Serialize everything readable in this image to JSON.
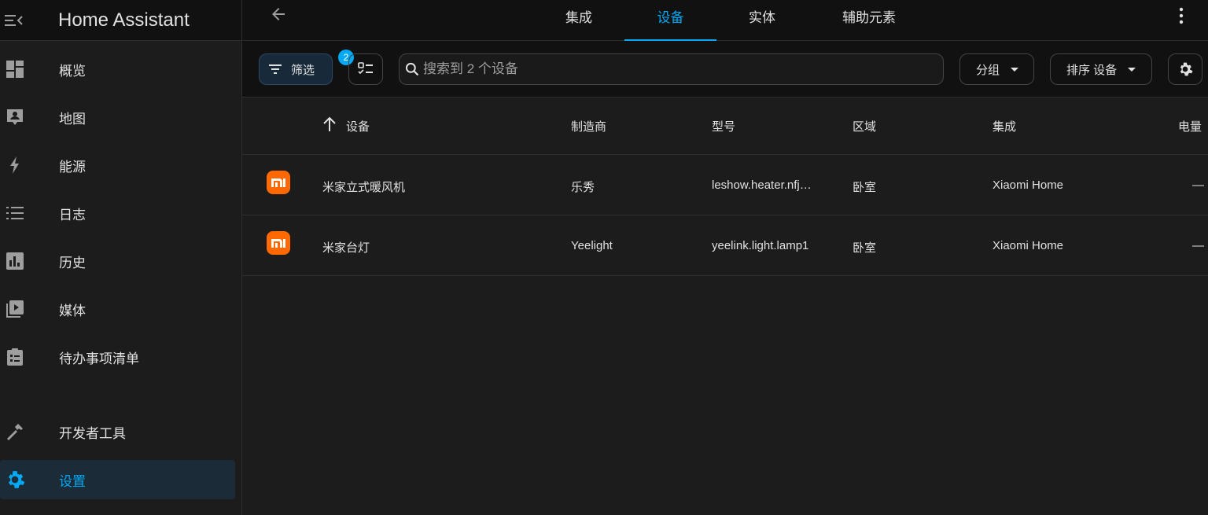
{
  "app": {
    "title": "Home Assistant"
  },
  "sidebar": {
    "items": [
      {
        "label": "概览",
        "icon": "dashboard-icon"
      },
      {
        "label": "地图",
        "icon": "map-account-icon"
      },
      {
        "label": "能源",
        "icon": "lightning-bolt-icon"
      },
      {
        "label": "日志",
        "icon": "list-icon"
      },
      {
        "label": "历史",
        "icon": "chart-box-icon"
      },
      {
        "label": "媒体",
        "icon": "play-box-multiple-icon"
      },
      {
        "label": "待办事项清单",
        "icon": "clipboard-list-icon"
      },
      {
        "label": "开发者工具",
        "icon": "hammer-icon"
      },
      {
        "label": "设置",
        "icon": "cog-icon",
        "active": true
      }
    ]
  },
  "tabs": [
    {
      "label": "集成"
    },
    {
      "label": "设备",
      "active": true
    },
    {
      "label": "实体"
    },
    {
      "label": "辅助元素"
    }
  ],
  "toolbar": {
    "filter_label": "筛选",
    "filter_count": "2",
    "search_placeholder": "搜索到 2 个设备",
    "group_label": "分组",
    "sort_label": "排序 设备"
  },
  "table": {
    "columns": [
      "设备",
      "制造商",
      "型号",
      "区域",
      "集成",
      "电量"
    ],
    "rows": [
      {
        "name": "米家立式暖风机",
        "manufacturer": "乐秀",
        "model": "leshow.heater.nfj…",
        "area": "卧室",
        "integration": "Xiaomi Home",
        "battery": "—"
      },
      {
        "name": "米家台灯",
        "manufacturer": "Yeelight",
        "model": "yeelink.light.lamp1",
        "area": "卧室",
        "integration": "Xiaomi Home",
        "battery": "—"
      }
    ]
  },
  "colors": {
    "accent": "#03a9f4",
    "brand_xiaomi": "#ff6900",
    "background": "#1c1c1c",
    "header": "#111111"
  }
}
